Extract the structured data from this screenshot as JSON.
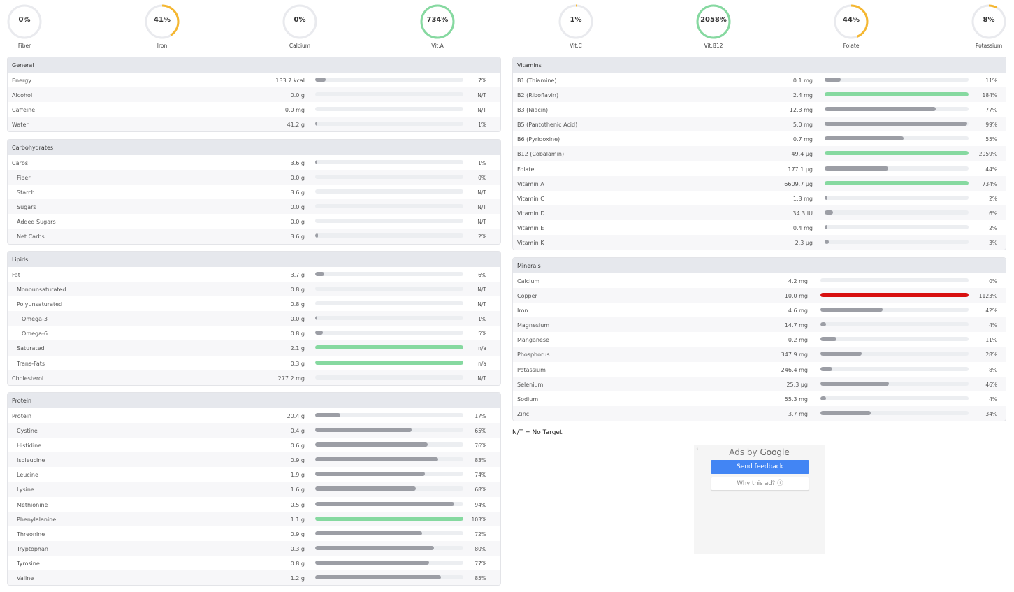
{
  "colors": {
    "ring_track": "#e9eaee",
    "ring_under": "#f5b731",
    "ring_over": "#86d9a0",
    "bar_normal": "#9c9ea5",
    "bar_over": "#86d9a0",
    "bar_toxic": "#d81010",
    "header_bg": "#e6e8ed"
  },
  "summary_rings": [
    {
      "label": "Fiber",
      "value": "0%",
      "fraction": 0.0,
      "status": "under"
    },
    {
      "label": "Iron",
      "value": "41%",
      "fraction": 0.41,
      "status": "under"
    },
    {
      "label": "Calcium",
      "value": "0%",
      "fraction": 0.0,
      "status": "under"
    },
    {
      "label": "Vit.A",
      "value": "734%",
      "fraction": 1.0,
      "status": "over"
    },
    {
      "label": "Vit.C",
      "value": "1%",
      "fraction": 0.01,
      "status": "under"
    },
    {
      "label": "Vit.B12",
      "value": "2058%",
      "fraction": 1.0,
      "status": "over"
    },
    {
      "label": "Folate",
      "value": "44%",
      "fraction": 0.44,
      "status": "under"
    },
    {
      "label": "Potassium",
      "value": "8%",
      "fraction": 0.08,
      "status": "under"
    }
  ],
  "general": {
    "title": "General",
    "rows": [
      {
        "name": "Energy",
        "amount": "133.7 kcal",
        "percent": "7%",
        "fill": 0.07,
        "indent": 0
      },
      {
        "name": "Alcohol",
        "amount": "0.0 g",
        "percent": "N/T",
        "fill": 0,
        "indent": 0
      },
      {
        "name": "Caffeine",
        "amount": "0.0 mg",
        "percent": "N/T",
        "fill": 0,
        "indent": 0
      },
      {
        "name": "Water",
        "amount": "41.2 g",
        "percent": "1%",
        "fill": 0.01,
        "indent": 0
      }
    ]
  },
  "carbohydrates": {
    "title": "Carbohydrates",
    "rows": [
      {
        "name": "Carbs",
        "amount": "3.6 g",
        "percent": "1%",
        "fill": 0.01,
        "indent": 0
      },
      {
        "name": "Fiber",
        "amount": "0.0 g",
        "percent": "0%",
        "fill": 0,
        "indent": 1
      },
      {
        "name": "Starch",
        "amount": "3.6 g",
        "percent": "N/T",
        "fill": 0,
        "indent": 1
      },
      {
        "name": "Sugars",
        "amount": "0.0 g",
        "percent": "N/T",
        "fill": 0,
        "indent": 1
      },
      {
        "name": "Added Sugars",
        "amount": "0.0 g",
        "percent": "N/T",
        "fill": 0,
        "indent": 1
      },
      {
        "name": "Net Carbs",
        "amount": "3.6 g",
        "percent": "2%",
        "fill": 0.02,
        "indent": 1
      }
    ]
  },
  "lipids": {
    "title": "Lipids",
    "rows": [
      {
        "name": "Fat",
        "amount": "3.7 g",
        "percent": "6%",
        "fill": 0.06,
        "indent": 0
      },
      {
        "name": "Monounsaturated",
        "amount": "0.8 g",
        "percent": "N/T",
        "fill": 0,
        "indent": 1
      },
      {
        "name": "Polyunsaturated",
        "amount": "0.8 g",
        "percent": "N/T",
        "fill": 0,
        "indent": 1
      },
      {
        "name": "Omega-3",
        "amount": "0.0 g",
        "percent": "1%",
        "fill": 0.01,
        "indent": 2
      },
      {
        "name": "Omega-6",
        "amount": "0.8 g",
        "percent": "5%",
        "fill": 0.05,
        "indent": 2
      },
      {
        "name": "Saturated",
        "amount": "2.1 g",
        "percent": "n/a",
        "fill": 1,
        "status": "over",
        "indent": 1
      },
      {
        "name": "Trans-Fats",
        "amount": "0.3 g",
        "percent": "n/a",
        "fill": 1,
        "status": "over",
        "indent": 1
      },
      {
        "name": "Cholesterol",
        "amount": "277.2 mg",
        "percent": "N/T",
        "fill": 0,
        "indent": 0
      }
    ]
  },
  "protein": {
    "title": "Protein",
    "rows": [
      {
        "name": "Protein",
        "amount": "20.4 g",
        "percent": "17%",
        "fill": 0.17,
        "indent": 0
      },
      {
        "name": "Cystine",
        "amount": "0.4 g",
        "percent": "65%",
        "fill": 0.65,
        "indent": 1
      },
      {
        "name": "Histidine",
        "amount": "0.6 g",
        "percent": "76%",
        "fill": 0.76,
        "indent": 1
      },
      {
        "name": "Isoleucine",
        "amount": "0.9 g",
        "percent": "83%",
        "fill": 0.83,
        "indent": 1
      },
      {
        "name": "Leucine",
        "amount": "1.9 g",
        "percent": "74%",
        "fill": 0.74,
        "indent": 1
      },
      {
        "name": "Lysine",
        "amount": "1.6 g",
        "percent": "68%",
        "fill": 0.68,
        "indent": 1
      },
      {
        "name": "Methionine",
        "amount": "0.5 g",
        "percent": "94%",
        "fill": 0.94,
        "indent": 1
      },
      {
        "name": "Phenylalanine",
        "amount": "1.1 g",
        "percent": "103%",
        "fill": 1,
        "status": "over",
        "indent": 1
      },
      {
        "name": "Threonine",
        "amount": "0.9 g",
        "percent": "72%",
        "fill": 0.72,
        "indent": 1
      },
      {
        "name": "Tryptophan",
        "amount": "0.3 g",
        "percent": "80%",
        "fill": 0.8,
        "indent": 1
      },
      {
        "name": "Tyrosine",
        "amount": "0.8 g",
        "percent": "77%",
        "fill": 0.77,
        "indent": 1
      },
      {
        "name": "Valine",
        "amount": "1.2 g",
        "percent": "85%",
        "fill": 0.85,
        "indent": 1
      }
    ]
  },
  "vitamins": {
    "title": "Vitamins",
    "rows": [
      {
        "name": "B1 (Thiamine)",
        "amount": "0.1 mg",
        "percent": "11%",
        "fill": 0.11
      },
      {
        "name": "B2 (Riboflavin)",
        "amount": "2.4 mg",
        "percent": "184%",
        "fill": 1,
        "status": "over"
      },
      {
        "name": "B3 (Niacin)",
        "amount": "12.3 mg",
        "percent": "77%",
        "fill": 0.77
      },
      {
        "name": "B5 (Pantothenic Acid)",
        "amount": "5.0 mg",
        "percent": "99%",
        "fill": 0.99
      },
      {
        "name": "B6 (Pyridoxine)",
        "amount": "0.7 mg",
        "percent": "55%",
        "fill": 0.55
      },
      {
        "name": "B12 (Cobalamin)",
        "amount": "49.4 µg",
        "percent": "2059%",
        "fill": 1,
        "status": "over"
      },
      {
        "name": "Folate",
        "amount": "177.1 µg",
        "percent": "44%",
        "fill": 0.44
      },
      {
        "name": "Vitamin A",
        "amount": "6609.7 µg",
        "percent": "734%",
        "fill": 1,
        "status": "over"
      },
      {
        "name": "Vitamin C",
        "amount": "1.3 mg",
        "percent": "2%",
        "fill": 0.02
      },
      {
        "name": "Vitamin D",
        "amount": "34.3 IU",
        "percent": "6%",
        "fill": 0.06
      },
      {
        "name": "Vitamin E",
        "amount": "0.4 mg",
        "percent": "2%",
        "fill": 0.02
      },
      {
        "name": "Vitamin K",
        "amount": "2.3 µg",
        "percent": "3%",
        "fill": 0.03
      }
    ]
  },
  "minerals": {
    "title": "Minerals",
    "rows": [
      {
        "name": "Calcium",
        "amount": "4.2 mg",
        "percent": "0%",
        "fill": 0
      },
      {
        "name": "Copper",
        "amount": "10.0 mg",
        "percent": "1123%",
        "fill": 1,
        "status": "toxic"
      },
      {
        "name": "Iron",
        "amount": "4.6 mg",
        "percent": "42%",
        "fill": 0.42
      },
      {
        "name": "Magnesium",
        "amount": "14.7 mg",
        "percent": "4%",
        "fill": 0.04
      },
      {
        "name": "Manganese",
        "amount": "0.2 mg",
        "percent": "11%",
        "fill": 0.11
      },
      {
        "name": "Phosphorus",
        "amount": "347.9 mg",
        "percent": "28%",
        "fill": 0.28
      },
      {
        "name": "Potassium",
        "amount": "246.4 mg",
        "percent": "8%",
        "fill": 0.08
      },
      {
        "name": "Selenium",
        "amount": "25.3 µg",
        "percent": "46%",
        "fill": 0.46
      },
      {
        "name": "Sodium",
        "amount": "55.3 mg",
        "percent": "4%",
        "fill": 0.04
      },
      {
        "name": "Zinc",
        "amount": "3.7 mg",
        "percent": "34%",
        "fill": 0.34
      }
    ]
  },
  "note": "N/T = No Target",
  "ad": {
    "back_icon": "back-arrow-icon",
    "title_prefix": "Ads by ",
    "title_brand": "Google",
    "send_feedback": "Send feedback",
    "why_this_ad": "Why this ad? ⓘ"
  }
}
